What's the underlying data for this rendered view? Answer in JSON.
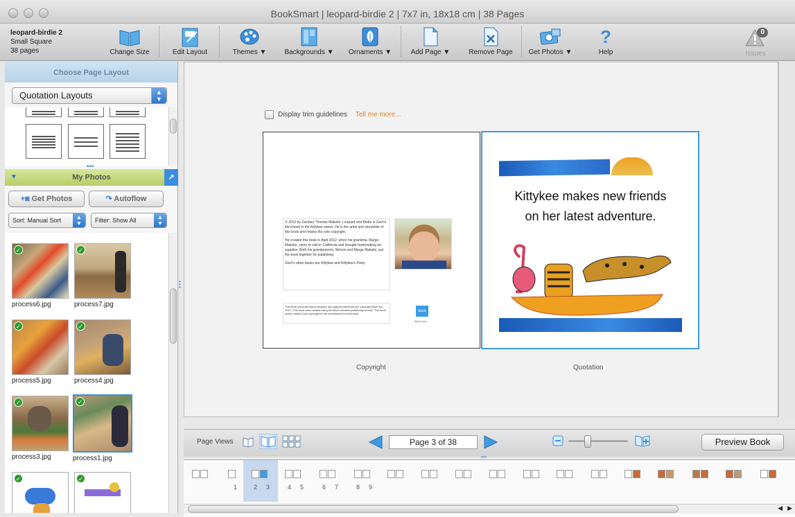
{
  "window": {
    "title": "BookSmart  |  leopard-birdie 2  |  7x7 in, 18x18 cm  |  38 Pages"
  },
  "book": {
    "name": "leopard-birdie 2",
    "size": "Small Square",
    "pages": "38 pages"
  },
  "toolbar": {
    "change_size": "Change Size",
    "edit_layout": "Edit Layout",
    "themes": "Themes ▼",
    "backgrounds": "Backgrounds ▼",
    "ornaments": "Ornaments ▼",
    "add_page": "Add Page ▼",
    "remove_page": "Remove Page",
    "get_photos": "Get Photos ▼",
    "help": "Help",
    "issues_label": "Issues",
    "issues_count": "0"
  },
  "layout_panel": {
    "header": "Choose Page Layout",
    "layout_select": "Quotation Layouts"
  },
  "photos_panel": {
    "header": "My Photos",
    "get_photos": "Get Photos",
    "autoflow": "Autoflow",
    "sort": "Sort:  Manual Sort",
    "filter": "Filter:  Show All",
    "photos": [
      {
        "name": "process6.jpg",
        "used": true
      },
      {
        "name": "process7.jpg",
        "used": true
      },
      {
        "name": "process5.jpg",
        "used": true
      },
      {
        "name": "process4.jpg",
        "used": true
      },
      {
        "name": "process3.jpg",
        "used": true
      },
      {
        "name": "process1.jpg",
        "used": true,
        "selected": true
      }
    ]
  },
  "canvas": {
    "trim_label": "Display trim guidelines",
    "tell_me_more": "Tell me more...",
    "left_page_label": "Copyright",
    "right_page_label": "Quotation",
    "quote_line1": "Kittykee makes new friends",
    "quote_line2": "on her latest adventure.",
    "copyright_p1": "© 2012 by Zachary Thomas Makeltz. Leopard and Birdie is Zach's third book in the Kittykee series. He is the artist and storyteller of this book and retains the sole copyright.",
    "copyright_p2": "He created this book in April 2012, when his grandma, Marge Makeltz, came to visit in California and brought bookmaking art supplies. Both his grandparents, Nelson and Marge Makeltz, put the book together for publishing.",
    "copyright_p3": "Zach's other books are Kittykee and Kittykee's Party.",
    "blurb_notice": "The Blurb-provided layout designs and graphic elements are copyright Blurb Inc., 2012. This book was created using the Blurb creative publishing service. The book author retains sole copyright to his contributions to this book.",
    "blurb_logo": "blurb",
    "blurb_url": "blurb.com"
  },
  "bottom": {
    "page_views": "Page Views",
    "page_indicator": "Page 3 of 38",
    "preview_book": "Preview Book"
  },
  "strip_numbers": [
    "1",
    "2",
    "3",
    "4",
    "5",
    "6",
    "7",
    "8",
    "9"
  ]
}
